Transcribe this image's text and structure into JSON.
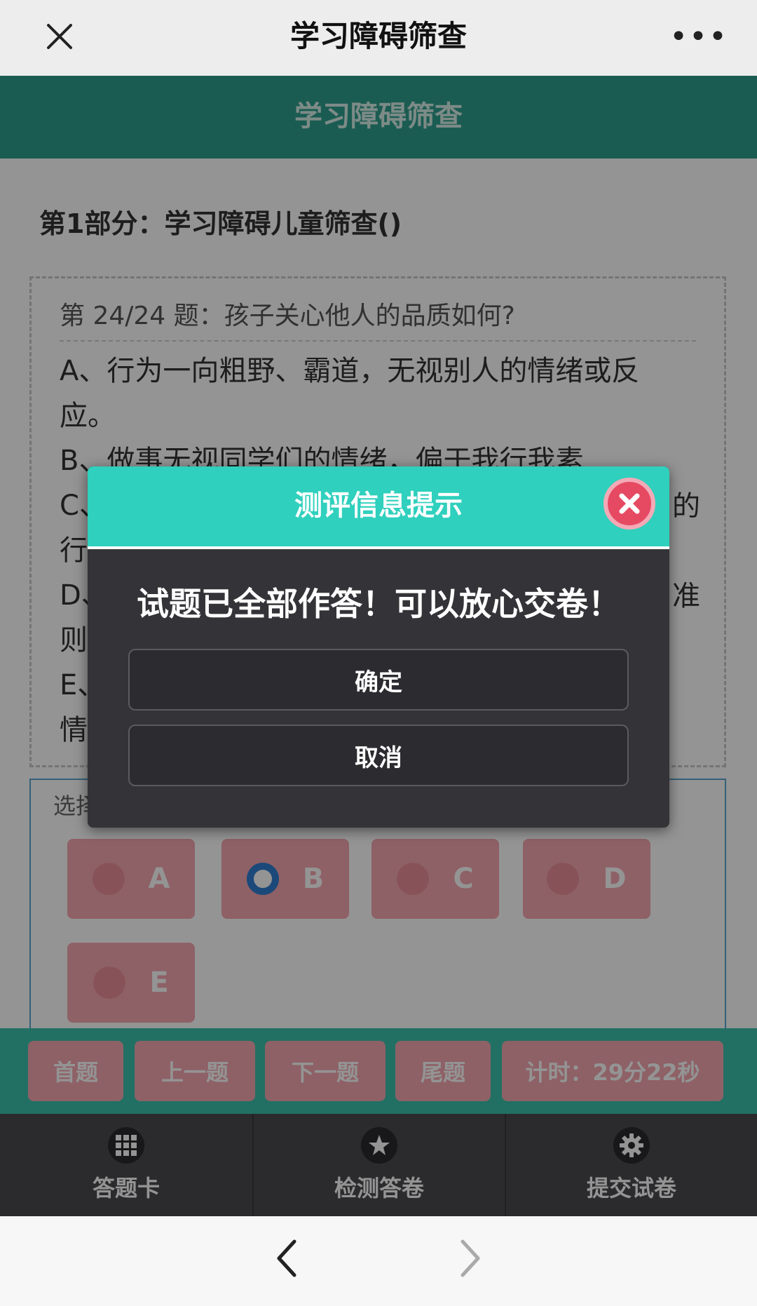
{
  "app": {
    "window_title": "学习障碍筛查",
    "more_label": "•••"
  },
  "header": {
    "title": "学习障碍筛查"
  },
  "section": {
    "title": "第1部分：学习障碍儿童筛查()"
  },
  "question": {
    "heading": "第 24/24 题：孩子关心他人的品质如何?",
    "option_lines": [
      "A、行为一向粗野、霸道，无视别人的情绪或反",
      "应。",
      "B、做事无视同学们的情绪，偏于我行我素",
      "C、",
      "行",
      "D、",
      "则",
      "E、",
      "情"
    ],
    "right_fragments": [
      "的",
      "准"
    ]
  },
  "choices": {
    "label": "选择",
    "items": [
      {
        "letter": "A",
        "selected": false
      },
      {
        "letter": "B",
        "selected": true
      },
      {
        "letter": "C",
        "selected": false
      },
      {
        "letter": "D",
        "selected": false
      },
      {
        "letter": "E",
        "selected": false
      }
    ]
  },
  "nav": {
    "first": "首题",
    "prev": "上一题",
    "next": "下一题",
    "last": "尾题",
    "timer": "计时：29分22秒"
  },
  "tabs": {
    "card": "答题卡",
    "check": "检测答卷",
    "submit": "提交试卷"
  },
  "modal": {
    "title": "测评信息提示",
    "message": "试题已全部作答！可以放心交卷！",
    "confirm": "确定",
    "cancel": "取消"
  },
  "colors": {
    "teal_header": "#2f9f8d",
    "modal_header": "#2fd0bd",
    "choice_pink": "#f4a7b0",
    "selected_radio": "#2f7fd1",
    "close_red": "#e64a63"
  }
}
